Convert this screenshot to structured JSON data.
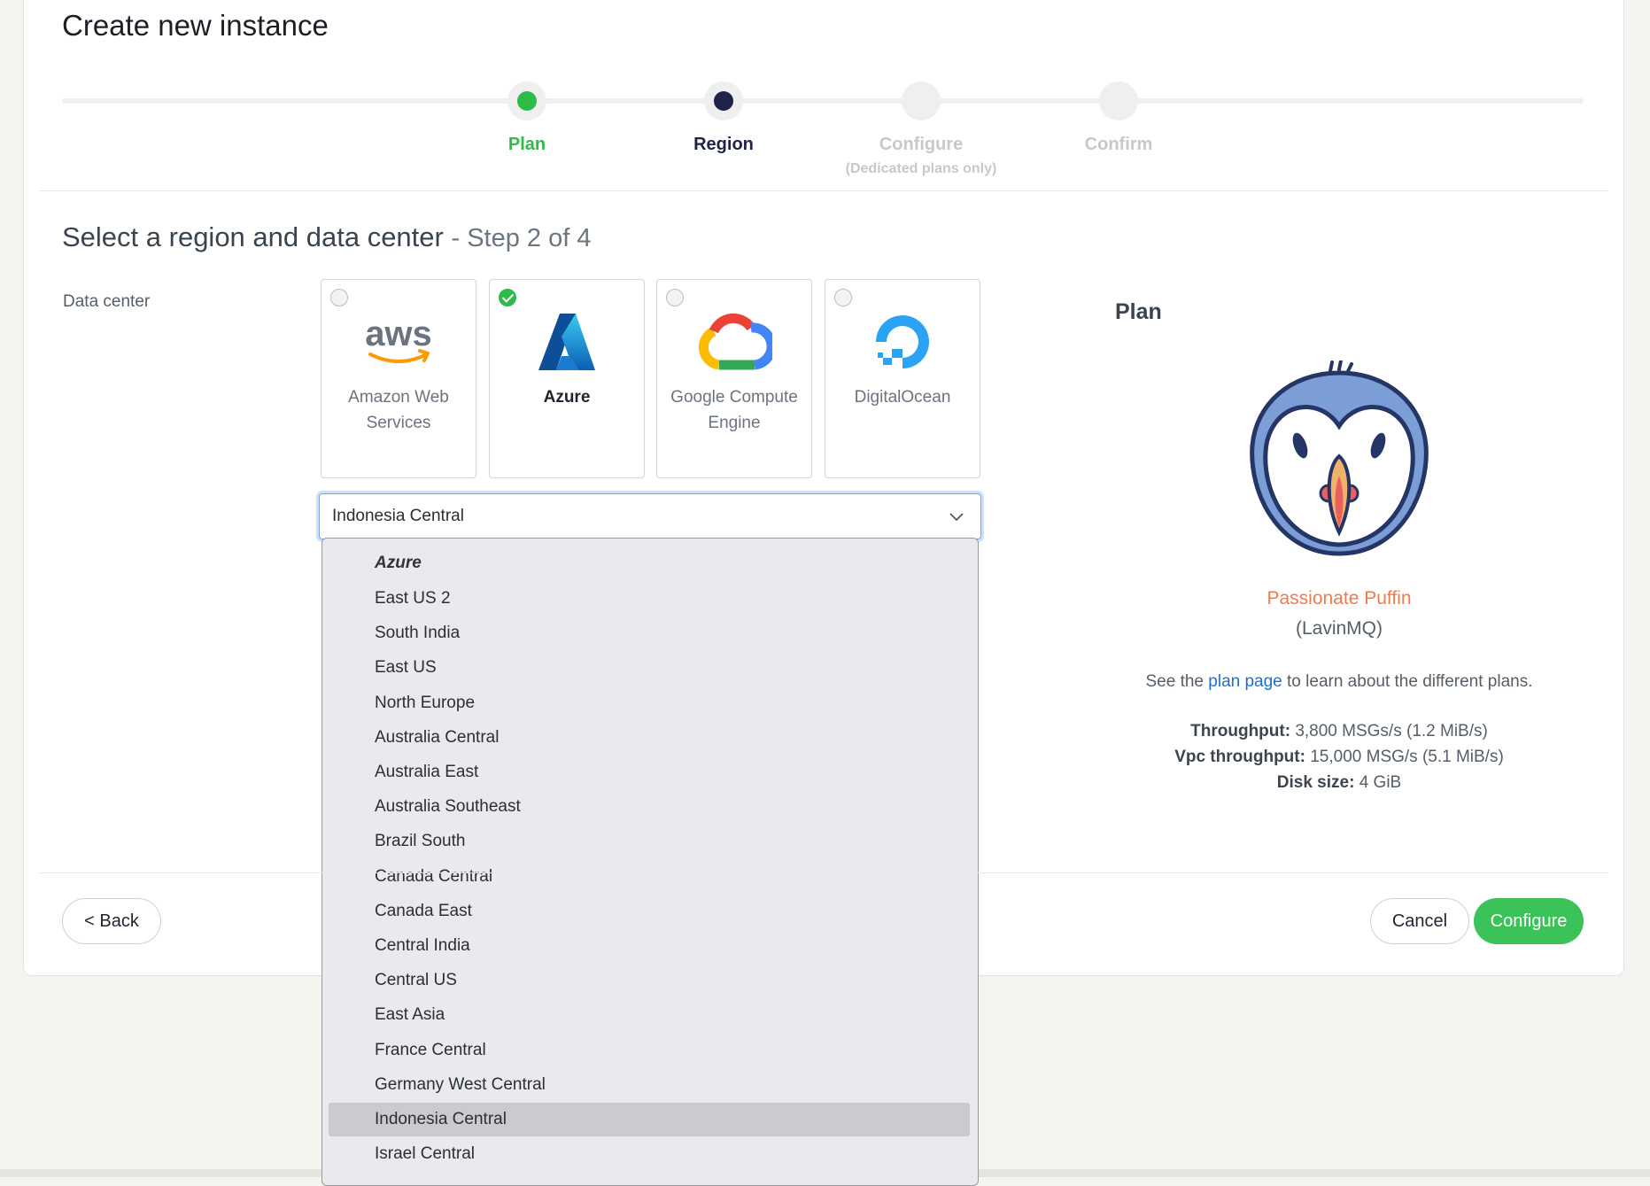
{
  "header": {
    "title": "Create new instance"
  },
  "stepper": {
    "steps": [
      {
        "label": "Plan",
        "sublabel": ""
      },
      {
        "label": "Region",
        "sublabel": ""
      },
      {
        "label": "Configure",
        "sublabel": "(Dedicated plans only)"
      },
      {
        "label": "Confirm",
        "sublabel": ""
      }
    ]
  },
  "section": {
    "title": "Select a region and data center",
    "step": "- Step 2 of 4"
  },
  "form": {
    "data_center_label": "Data center"
  },
  "providers": [
    {
      "name": "Amazon Web Services",
      "icon": "aws-logo-icon",
      "selected": false
    },
    {
      "name": "Azure",
      "icon": "azure-logo-icon",
      "selected": true
    },
    {
      "name": "Google Compute Engine",
      "icon": "google-cloud-logo-icon",
      "selected": false
    },
    {
      "name": "DigitalOcean",
      "icon": "digitalocean-logo-icon",
      "selected": false
    }
  ],
  "region_select": {
    "value": "Indonesia Central",
    "group": "Azure",
    "options": [
      "East US 2",
      "South India",
      "East US",
      "North Europe",
      "Australia Central",
      "Australia East",
      "Australia Southeast",
      "Brazil South",
      "Canada Central",
      "Canada East",
      "Central India",
      "Central US",
      "East Asia",
      "France Central",
      "Germany West Central",
      "Indonesia Central",
      "Israel Central"
    ],
    "selected_index": 15
  },
  "plan": {
    "heading": "Plan",
    "name": "Passionate Puffin",
    "product": "(LavinMQ)",
    "info_prefix": "See the ",
    "info_link": "plan page",
    "info_suffix": " to learn about the different plans.",
    "throughput_label": "Throughput:",
    "throughput_value": "3,800 MSGs/s (1.2 MiB/s)",
    "vpc_label": "Vpc throughput:",
    "vpc_value": "15,000 MSG/s (5.1 MiB/s)",
    "disk_label": "Disk size:",
    "disk_value": "4 GiB"
  },
  "actions": {
    "back": "< Back",
    "cancel": "Cancel",
    "configure": "Configure"
  },
  "colors": {
    "accent": "#3bc35a",
    "active_step": "#1f2347",
    "plan_name": "#f07b4d",
    "link": "#1f6fd1"
  }
}
